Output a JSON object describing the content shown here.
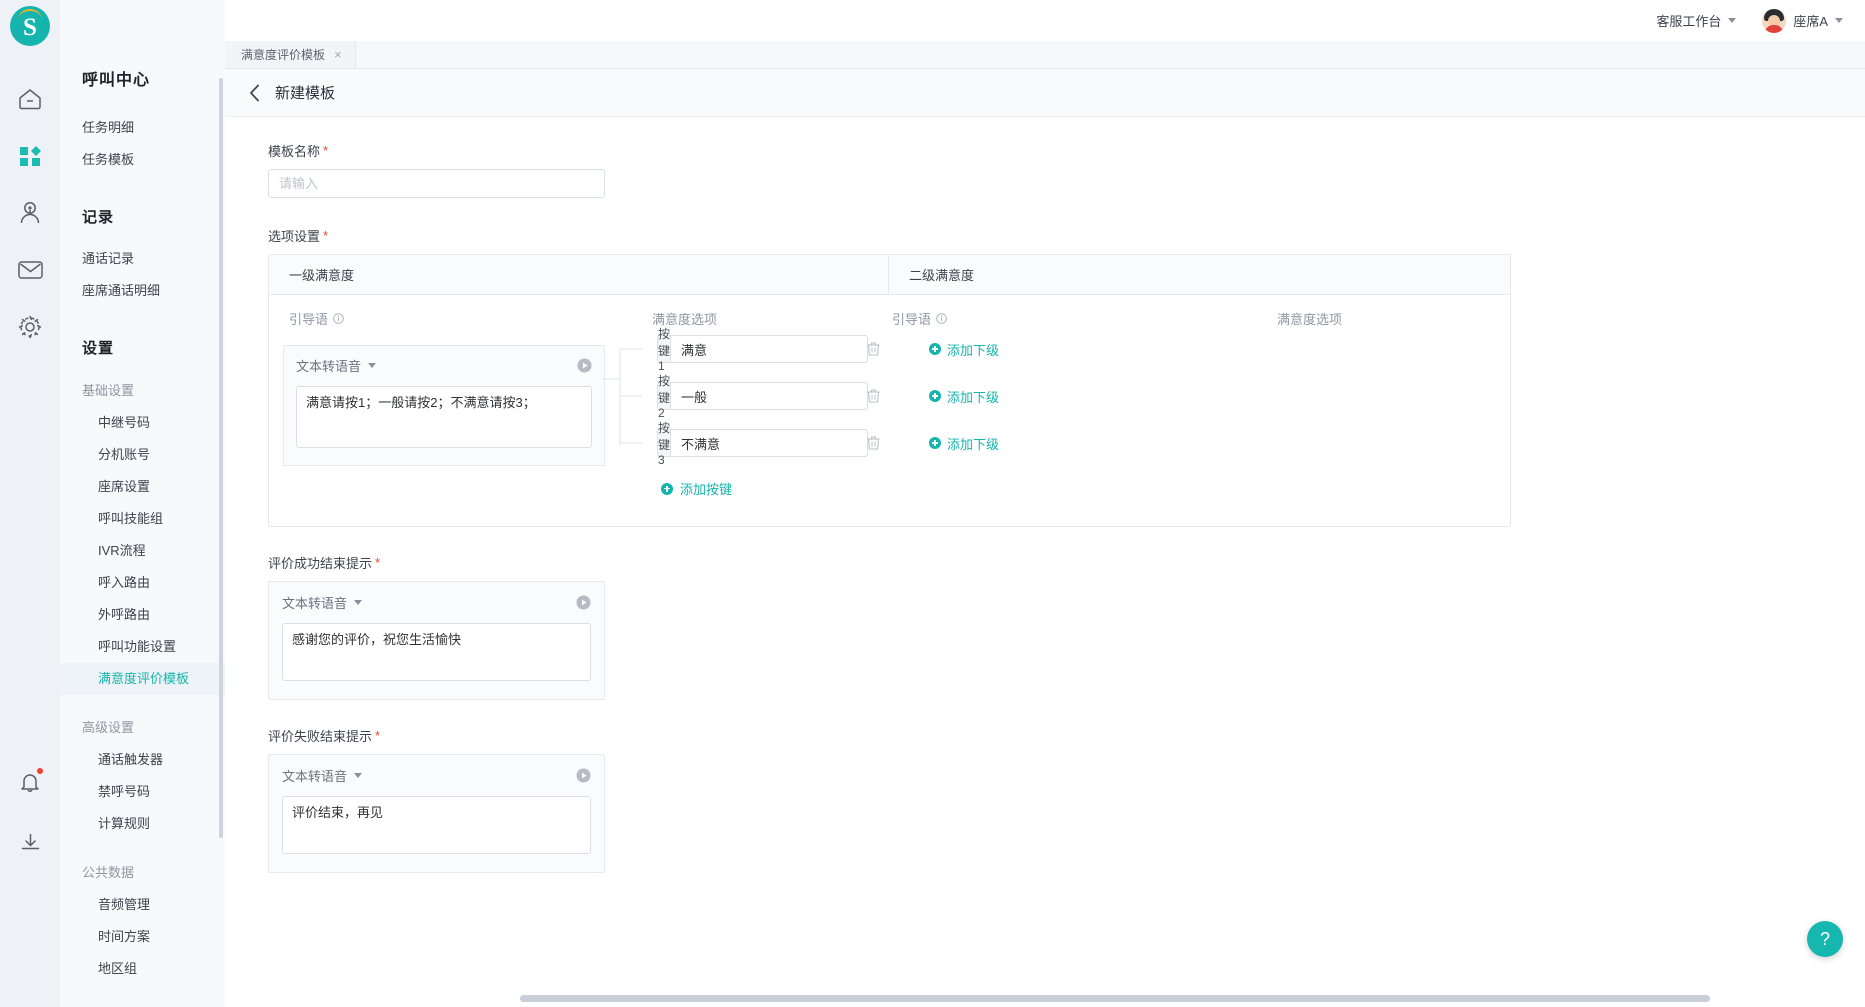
{
  "brand": {
    "logo_letter": "S",
    "accent": "#15b5ad"
  },
  "topbar": {
    "workbench_label": "客服工作台",
    "user_label": "座席A"
  },
  "tabbar": {
    "tabs": [
      {
        "label": "满意度评价模板",
        "close": "×"
      }
    ]
  },
  "pagehead": {
    "title": "新建模板"
  },
  "sidebar": {
    "title": "呼叫中心",
    "items": [
      {
        "label": "任务明细"
      },
      {
        "label": "任务模板"
      }
    ],
    "groups": [
      {
        "title": "记录",
        "items": [
          {
            "label": "通话记录"
          },
          {
            "label": "座席通话明细"
          }
        ]
      },
      {
        "title": "设置",
        "subgroups": [
          {
            "title": "基础设置",
            "items": [
              {
                "label": "中继号码",
                "active": false
              },
              {
                "label": "分机账号",
                "active": false
              },
              {
                "label": "座席设置",
                "active": false
              },
              {
                "label": "呼叫技能组",
                "active": false
              },
              {
                "label": "IVR流程",
                "active": false
              },
              {
                "label": "呼入路由",
                "active": false
              },
              {
                "label": "外呼路由",
                "active": false
              },
              {
                "label": "呼叫功能设置",
                "active": false
              },
              {
                "label": "满意度评价模板",
                "active": true
              }
            ]
          },
          {
            "title": "高级设置",
            "items": [
              {
                "label": "通话触发器"
              },
              {
                "label": "禁呼号码"
              },
              {
                "label": "计算规则"
              }
            ]
          },
          {
            "title": "公共数据",
            "items": [
              {
                "label": "音频管理"
              },
              {
                "label": "时间方案"
              },
              {
                "label": "地区组"
              }
            ]
          }
        ]
      }
    ]
  },
  "form": {
    "template_name": {
      "label": "模板名称",
      "required_mark": "*",
      "value": "",
      "placeholder": "请输入"
    },
    "option_settings": {
      "label": "选项设置",
      "required_mark": "*",
      "columns": [
        {
          "label": "一级满意度"
        },
        {
          "label": "二级满意度"
        }
      ],
      "sub_columns": [
        {
          "label": "引导语",
          "has_info": true
        },
        {
          "label": "满意度选项",
          "has_info": false
        },
        {
          "label": "引导语",
          "has_info": true
        },
        {
          "label": "满意度选项",
          "has_info": false
        }
      ],
      "level1_prompt": {
        "type_label": "文本转语音",
        "text": "满意请按1；一般请按2；不满意请按3；"
      },
      "keys": [
        {
          "key_label": "按键 1",
          "value": "满意",
          "add_child_label": "添加下级"
        },
        {
          "key_label": "按键 2",
          "value": "一般",
          "add_child_label": "添加下级"
        },
        {
          "key_label": "按键 3",
          "value": "不满意",
          "add_child_label": "添加下级"
        }
      ],
      "add_key_label": "添加按键"
    },
    "success_prompt": {
      "label": "评价成功结束提示",
      "required_mark": "*",
      "type_label": "文本转语音",
      "text": "感谢您的评价，祝您生活愉快"
    },
    "fail_prompt": {
      "label": "评价失败结束提示",
      "required_mark": "*",
      "type_label": "文本转语音",
      "text": "评价结束，再见"
    }
  },
  "help_fab": {
    "glyph": "?"
  }
}
